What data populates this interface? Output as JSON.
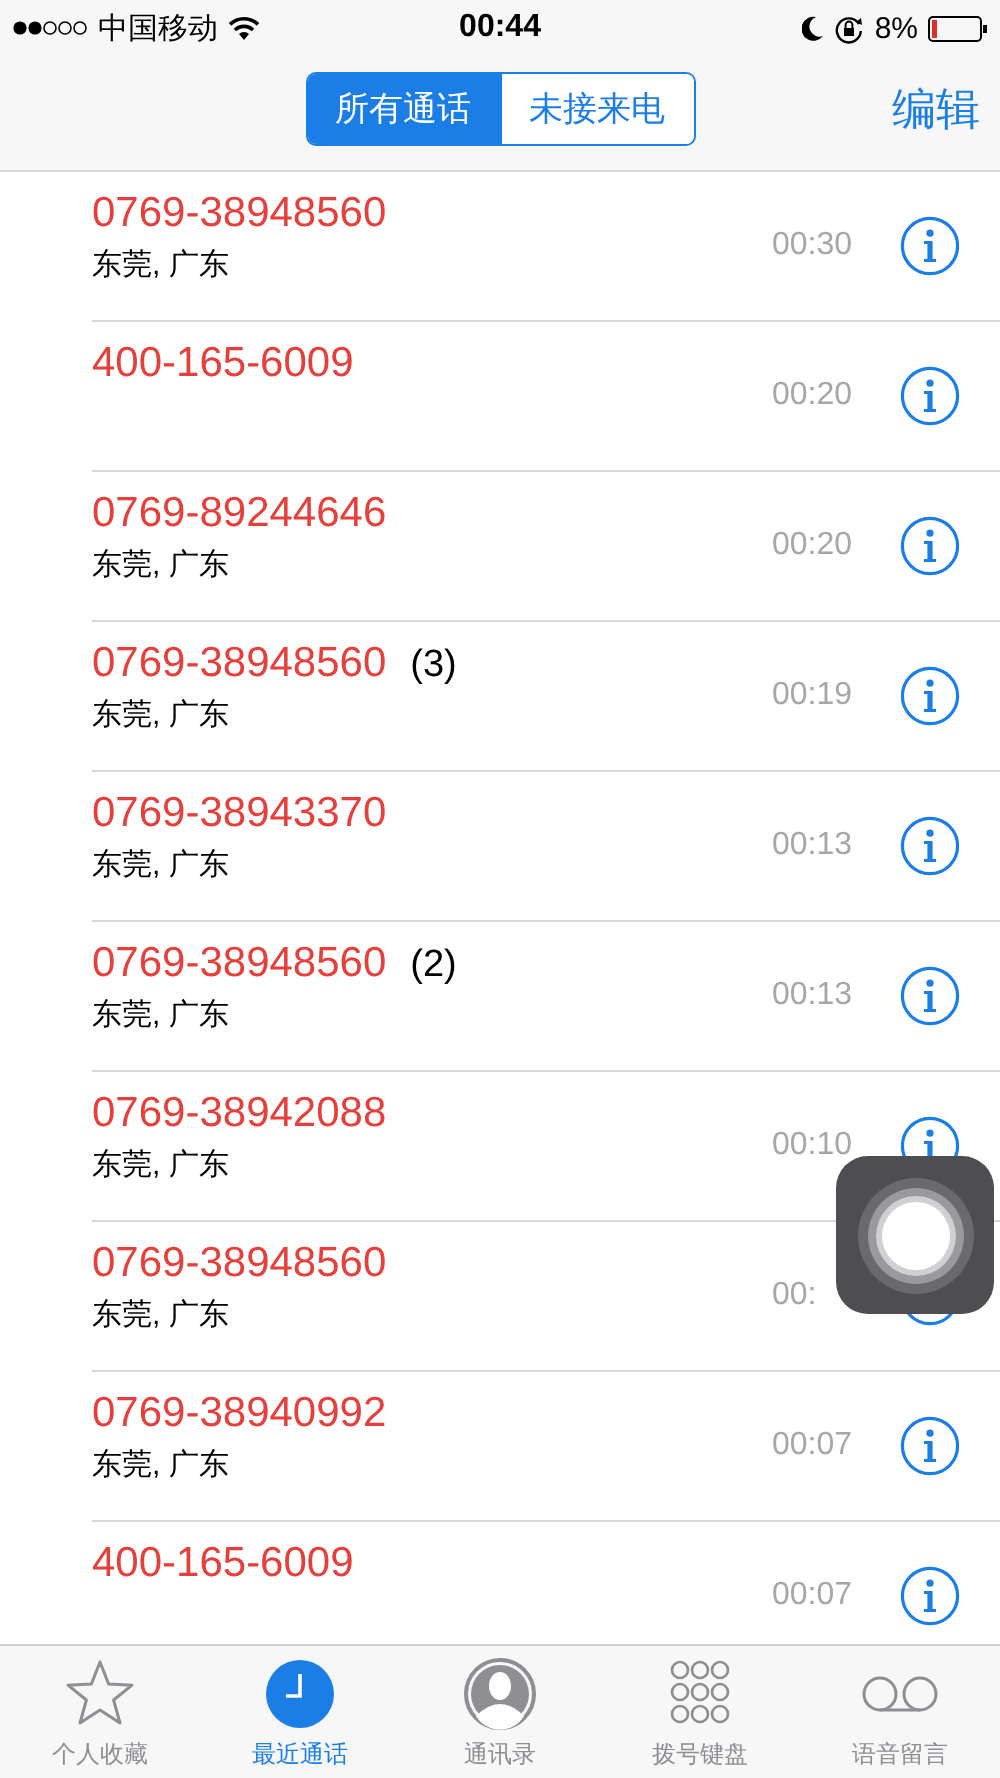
{
  "status_bar": {
    "carrier": "中国移动",
    "time": "00:44",
    "battery": "8%"
  },
  "segments": [
    {
      "label": "所有通话",
      "selected": true
    },
    {
      "label": "未接来电",
      "selected": false
    }
  ],
  "edit_button": "编辑",
  "calls": [
    {
      "number": "0769-38948560",
      "location": "东莞, 广东",
      "time": "00:30"
    },
    {
      "number": "400-165-6009",
      "time": "00:20"
    },
    {
      "number": "0769-89244646",
      "location": "东莞, 广东",
      "time": "00:20"
    },
    {
      "number": "0769-38948560",
      "count": "(3)",
      "location": "东莞, 广东",
      "time": "00:19"
    },
    {
      "number": "0769-38943370",
      "location": "东莞, 广东",
      "time": "00:13"
    },
    {
      "number": "0769-38948560",
      "count": "(2)",
      "location": "东莞, 广东",
      "time": "00:13"
    },
    {
      "number": "0769-38942088",
      "location": "东莞, 广东",
      "time": "00:10"
    },
    {
      "number": "0769-38948560",
      "location": "东莞, 广东",
      "time": "00:"
    },
    {
      "number": "0769-38940992",
      "location": "东莞, 广东",
      "time": "00:07"
    },
    {
      "number": "400-165-6009",
      "time": "00:07"
    }
  ],
  "tabs": [
    {
      "label": "个人收藏",
      "selected": false
    },
    {
      "label": "最近通话",
      "selected": true
    },
    {
      "label": "通讯录",
      "selected": false
    },
    {
      "label": "拨号键盘",
      "selected": false
    },
    {
      "label": "语音留言",
      "selected": false
    }
  ]
}
